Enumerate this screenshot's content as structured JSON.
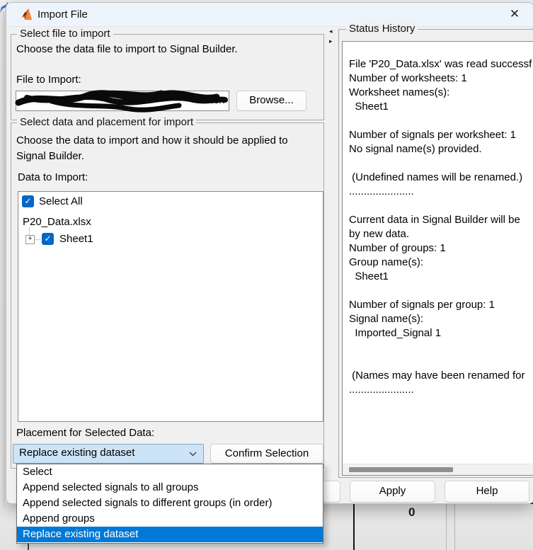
{
  "window": {
    "title": "Import File",
    "close_glyph": "✕"
  },
  "file_section": {
    "legend": "Select file to import",
    "description": "Choose the data file to import to Signal Builder.",
    "file_label": "File to Import:",
    "file_value_visible_fragment": "lsx",
    "browse_label": "Browse..."
  },
  "data_section": {
    "legend": "Select data and placement for import",
    "description_line1": "Choose the data to import and how it should be applied to",
    "description_line2": "Signal Builder.",
    "list_label": "Data to Import:",
    "tree": {
      "select_all_label": "Select All",
      "file_node": "P20_Data.xlsx",
      "sheet_node": "Sheet1",
      "expander_glyph": "+",
      "check_glyph": "✓"
    },
    "placement_label": "Placement for Selected Data:",
    "combo_value": "Replace existing dataset",
    "confirm_label": "Confirm Selection",
    "options": [
      "Select",
      "Append selected signals to all groups",
      "Append selected signals to different groups (in order)",
      "Append groups",
      "Replace existing dataset"
    ],
    "selected_option_index": 4
  },
  "status_history": {
    "legend": "Status History",
    "lines": [
      "File 'P20_Data.xlsx' was read successf",
      "Number of worksheets: 1",
      "Worksheet names(s):",
      "  Sheet1",
      "",
      "Number of signals per worksheet: 1",
      "No signal name(s) provided.",
      "",
      " (Undefined names will be renamed.)",
      "......................",
      "",
      "Current data in Signal Builder will be",
      "by new data.",
      "Number of groups: 1",
      "Group name(s):",
      "  Sheet1",
      "",
      "Number of signals per group: 1",
      "Signal name(s):",
      "  Imported_Signal 1",
      "",
      "",
      " (Names may have been renamed for",
      "......................"
    ]
  },
  "buttons": {
    "apply": "Apply",
    "help": "Help"
  },
  "background": {
    "axis_zero_label": "0"
  },
  "colors": {
    "accent": "#0078d7",
    "checkbox_blue": "#0068c7",
    "combo_focus_bg": "#cde4f6",
    "titlebar_bg": "#eef4fb",
    "dialog_bg": "#f0f0f0"
  }
}
